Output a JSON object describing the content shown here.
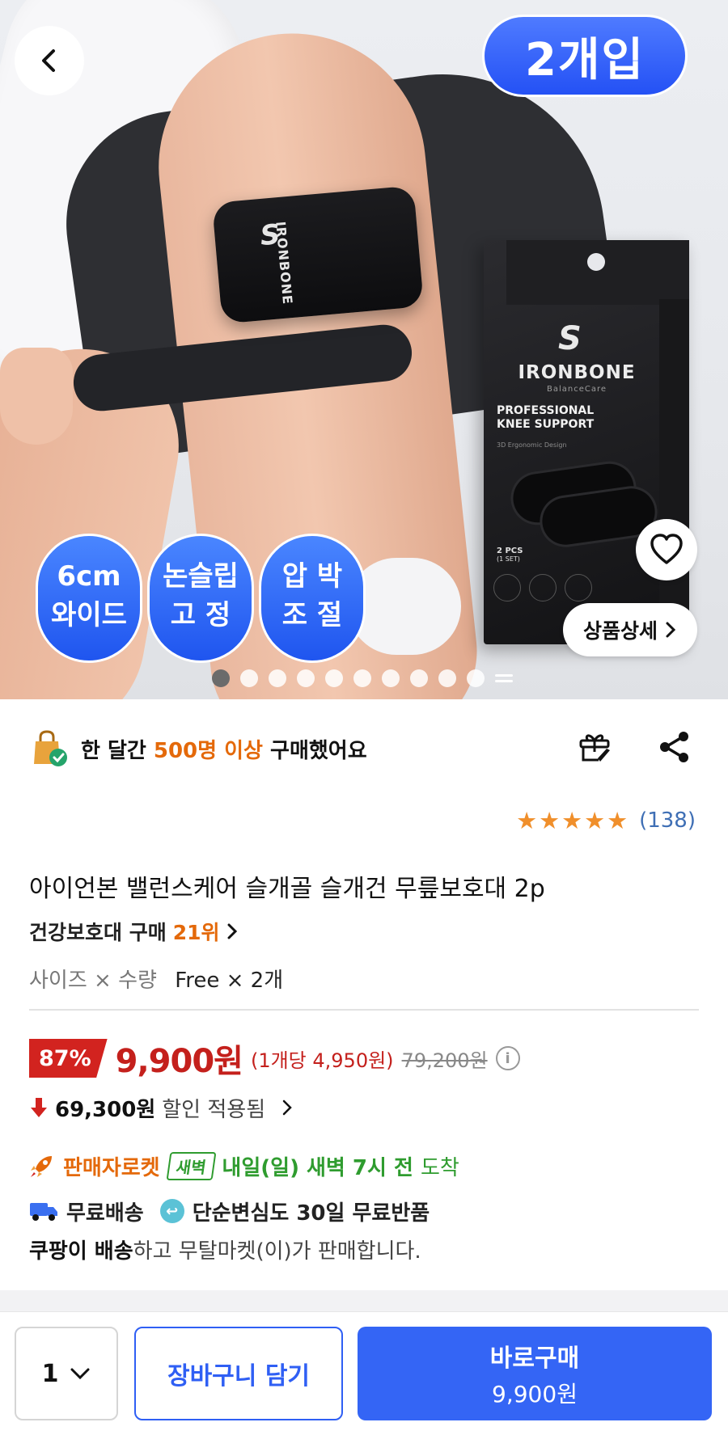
{
  "hero": {
    "count_badge": "2개입",
    "strap_logo": "IRONBONE",
    "box": {
      "brand": "IRONBONE",
      "sub": "BalanceCare",
      "product_line1": "PROFESSIONAL",
      "product_line2": "KNEE SUPPORT",
      "design": "3D Ergonomic Design",
      "pcs": "2 PCS",
      "set": "(1 SET)"
    },
    "features": [
      {
        "line1": "6cm",
        "line2": "와이드"
      },
      {
        "line1": "논슬립",
        "line2": "고 정"
      },
      {
        "line1": "압 박",
        "line2": "조 절"
      }
    ],
    "detail_button": "상품상세",
    "image_count": 10,
    "active_image": 1
  },
  "social_proof": {
    "prefix": "한 달간",
    "highlight": "500명 이상",
    "suffix": "구매했어요"
  },
  "rating": {
    "stars": 5,
    "count": "(138)"
  },
  "product": {
    "title": "아이언본 밸런스케어 슬개골 슬개건 무릎보호대 2p",
    "rank_category": "건강보호대 구매",
    "rank": "21위",
    "option_label": "사이즈 × 수량",
    "option_value": "Free × 2개"
  },
  "price": {
    "discount": "87%",
    "sale": "9,900원",
    "unit": "(1개당 4,950원)",
    "original": "79,200원",
    "coupon_amount": "69,300원",
    "coupon_text": "할인 적용됨"
  },
  "delivery": {
    "seller_rocket": "판매자로켓",
    "dawn_tag": "새벽",
    "arrival_strong": "내일(일) 새벽 7시 전",
    "arrival_tail": "도착",
    "free_shipping": "무료배송",
    "free_return": "단순변심도 30일 무료반품",
    "shipper_strong": "쿠팡이 배송",
    "shipper_tail": "하고 무탈마켓(이)가 판매합니다."
  },
  "bottom_bar": {
    "quantity": "1",
    "cart": "장바구니 담기",
    "buy": "바로구매",
    "buy_price": "9,900원"
  },
  "colors": {
    "accent_blue": "#3465f5",
    "sale_red": "#c4201c",
    "orange": "#e4690a",
    "green": "#2f9c2f"
  }
}
